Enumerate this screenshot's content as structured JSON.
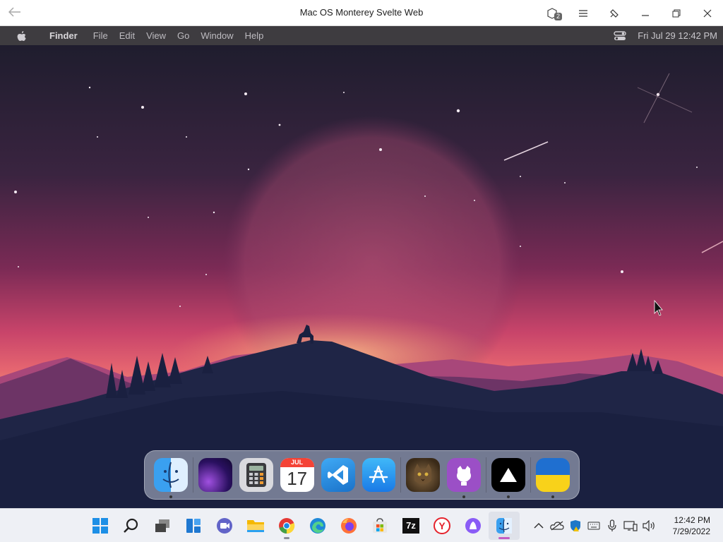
{
  "window": {
    "title": "Mac OS Monterey Svelte Web",
    "back_icon": "back-arrow-icon",
    "tab_count_badge": "2",
    "controls": [
      "collections-icon",
      "menu-icon",
      "extensions-icon",
      "minimize-icon",
      "restore-icon",
      "close-icon"
    ]
  },
  "menubar": {
    "app_name": "Finder",
    "items": [
      "File",
      "Edit",
      "View",
      "Go",
      "Window",
      "Help"
    ],
    "date_time": "Fri Jul 29  12:42 PM"
  },
  "dock": {
    "apps": [
      {
        "name": "Finder",
        "icon": "finder-icon",
        "running": true
      },
      {
        "name": "Wallpapers",
        "icon": "wallpapers-icon",
        "running": false
      },
      {
        "name": "Calculator",
        "icon": "calculator-icon",
        "running": false
      },
      {
        "name": "Calendar",
        "icon": "calendar-icon",
        "running": false,
        "month": "JUL",
        "day": "17"
      },
      {
        "name": "VS Code",
        "icon": "vscode-icon",
        "running": false
      },
      {
        "name": "App Store",
        "icon": "app-store-icon",
        "running": false
      },
      {
        "name": "Cat",
        "icon": "cat-photo-icon",
        "running": false
      },
      {
        "name": "GitHub",
        "icon": "github-icon",
        "running": true
      },
      {
        "name": "Vercel",
        "icon": "vercel-icon",
        "running": true
      },
      {
        "name": "Ukraine",
        "icon": "ukraine-flag-icon",
        "running": true
      }
    ]
  },
  "taskbar": {
    "apps": [
      {
        "name": "Start",
        "icon": "windows-start-icon",
        "running": false
      },
      {
        "name": "Search",
        "icon": "search-icon",
        "running": false
      },
      {
        "name": "Task View",
        "icon": "task-view-icon",
        "running": false
      },
      {
        "name": "Widgets",
        "icon": "widgets-icon",
        "running": false
      },
      {
        "name": "Teams Chat",
        "icon": "teams-chat-icon",
        "running": false
      },
      {
        "name": "File Explorer",
        "icon": "file-explorer-icon",
        "running": false
      },
      {
        "name": "Chrome",
        "icon": "chrome-icon",
        "running": true
      },
      {
        "name": "Edge",
        "icon": "edge-icon",
        "running": false
      },
      {
        "name": "Firefox",
        "icon": "firefox-icon",
        "running": false
      },
      {
        "name": "Microsoft Store",
        "icon": "store-icon",
        "running": false
      },
      {
        "name": "7-Zip",
        "icon": "7zip-icon",
        "running": false,
        "label": "7z"
      },
      {
        "name": "Yandex",
        "icon": "yandex-icon",
        "running": false,
        "label": "Y"
      },
      {
        "name": "Alice",
        "icon": "alice-icon",
        "running": false
      },
      {
        "name": "Mac OS Monterey Svelte Web",
        "icon": "finder-icon",
        "running": true,
        "active": true
      }
    ],
    "tray": [
      "chevron-up-icon",
      "onedrive-icon",
      "defender-icon",
      "keyboard-icon",
      "microphone-icon",
      "network-icon",
      "volume-icon"
    ],
    "time": "12:42 PM",
    "date": "7/29/2022"
  },
  "colors": {
    "sky_top": "#1f1d2e",
    "sky_mid": "#8c2a5a",
    "horizon": "#f08a6a",
    "hills_dark": "#1b2240",
    "accent": "#c45ec4"
  }
}
